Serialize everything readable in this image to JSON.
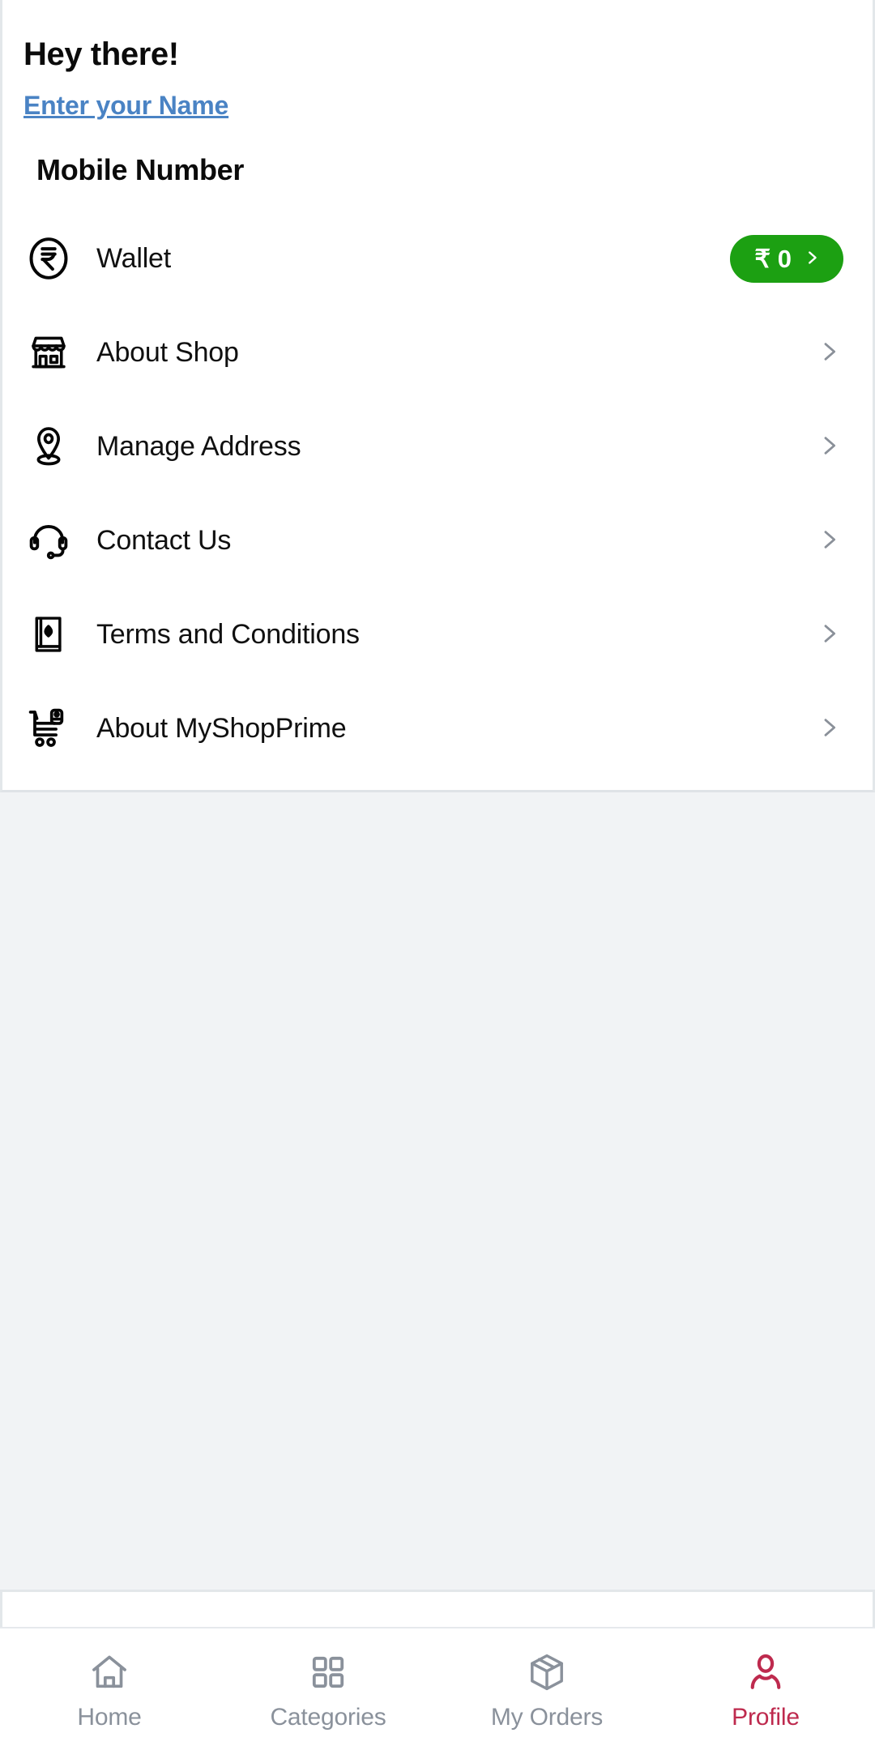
{
  "profile": {
    "greeting": "Hey there!",
    "name_link": "Enter your Name",
    "mobile_number_label": "Mobile Number"
  },
  "wallet": {
    "label": "Wallet",
    "icon": "rupee-circle-icon",
    "badge_amount": "₹ 0",
    "badge_color": "#1CA012"
  },
  "menu": {
    "items": [
      {
        "label": "About Shop",
        "icon": "storefront-icon"
      },
      {
        "label": "Manage Address",
        "icon": "location-pin-icon"
      },
      {
        "label": "Contact Us",
        "icon": "headset-icon"
      },
      {
        "label": "Terms and Conditions",
        "icon": "book-icon"
      },
      {
        "label": "About MyShopPrime",
        "icon": "shopping-cart-icon"
      }
    ]
  },
  "bottom_nav": {
    "items": [
      {
        "label": "Home",
        "icon": "home-icon",
        "active": false
      },
      {
        "label": "Categories",
        "icon": "grid-icon",
        "active": false
      },
      {
        "label": "My Orders",
        "icon": "package-box-icon",
        "active": false
      },
      {
        "label": "Profile",
        "icon": "person-icon",
        "active": true
      }
    ],
    "active_color": "#BE2A4E",
    "inactive_color": "#8A919B"
  },
  "theme": {
    "page_background": "#F1F3F5",
    "card_background": "#FFFFFF",
    "link_blue": "#4A83C4",
    "text_primary": "#101010",
    "chevron_gray": "#8A9099"
  }
}
